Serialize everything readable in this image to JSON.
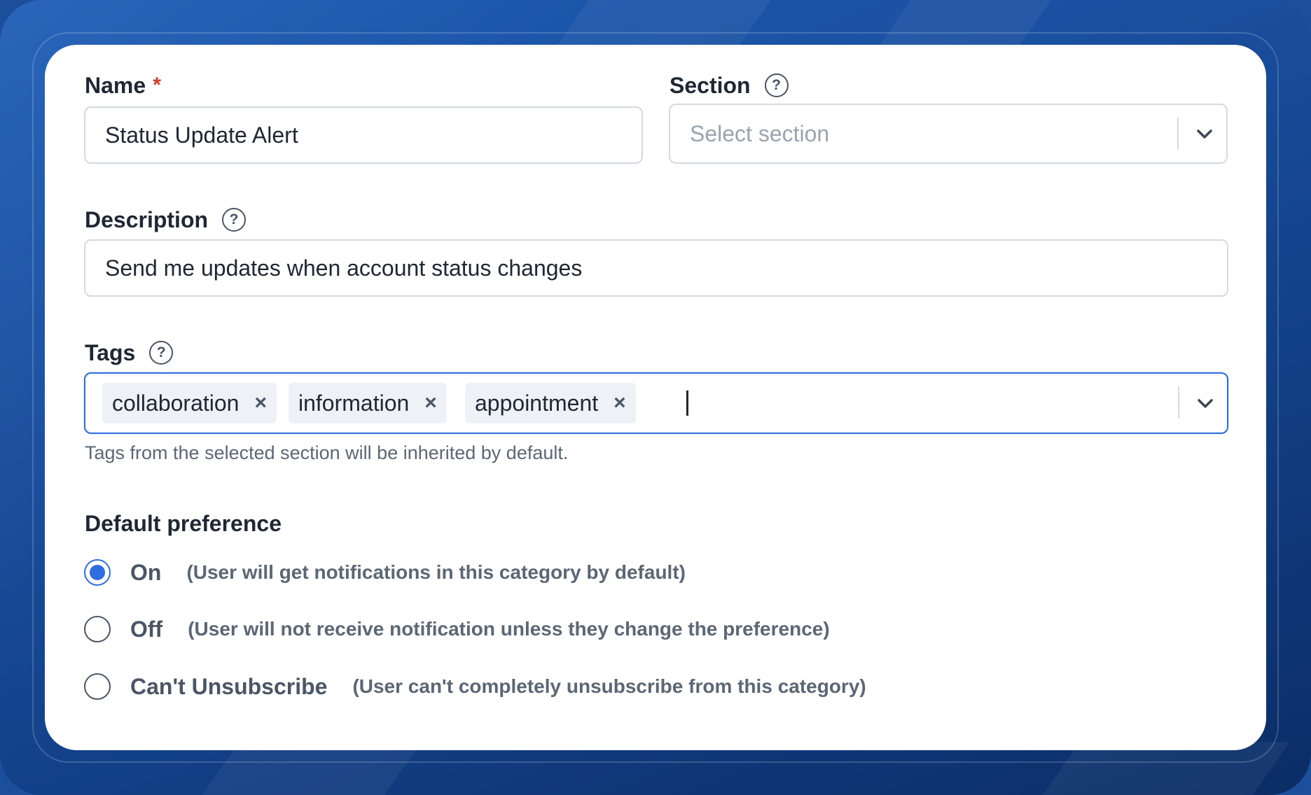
{
  "name_field": {
    "label": "Name",
    "required_marker": "*",
    "value": "Status Update Alert"
  },
  "section_field": {
    "label": "Section",
    "placeholder": "Select section",
    "help_icon": "question-circle-icon"
  },
  "description_field": {
    "label": "Description",
    "value": "Send me updates when account status changes",
    "help_icon": "question-circle-icon"
  },
  "tags_field": {
    "label": "Tags",
    "help_icon": "question-circle-icon",
    "tags": [
      {
        "label": "collaboration",
        "remove": "×"
      },
      {
        "label": "information",
        "remove": "×"
      },
      {
        "label": "appointment",
        "remove": "×"
      }
    ],
    "hint": "Tags from the selected section will be inherited by default."
  },
  "default_preference": {
    "title": "Default preference",
    "options": [
      {
        "label": "On",
        "description": "(User will get notifications in this category by default)",
        "checked": true
      },
      {
        "label": "Off",
        "description": "(User will not receive notification unless they change the preference)",
        "checked": false
      },
      {
        "label": "Can't Unsubscribe",
        "description": "(User can't completely unsubscribe from this category)",
        "checked": false
      }
    ]
  },
  "colors": {
    "accent": "#2f6de0",
    "required": "#d23b2a",
    "background": "#1b4f9c"
  }
}
